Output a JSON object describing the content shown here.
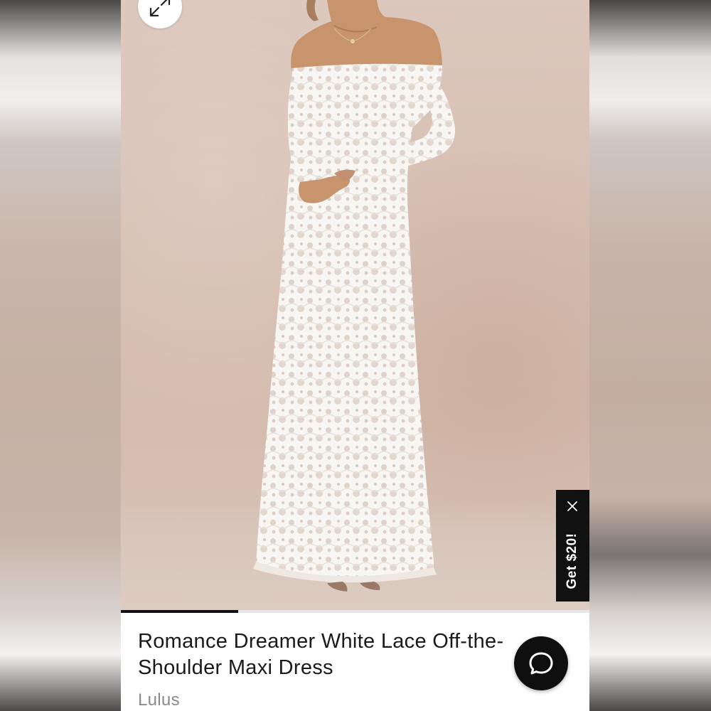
{
  "product": {
    "title_line1": "Romance Dreamer White Lace Off-the-",
    "title_line2": "Shoulder Maxi Dress",
    "brand": "Lulus"
  },
  "image_gallery": {
    "progress_fraction": 0.25
  },
  "promo": {
    "label": "Get $20!",
    "close_icon": "close-icon"
  },
  "icons": {
    "expand": "expand-arrows-icon",
    "chat": "chat-bubble-icon"
  },
  "colors": {
    "backdrop": "#d6bfb2",
    "dress": "#f7f4f1",
    "promo_bg": "#111111",
    "chat_bg": "#0f0f10",
    "brand_text": "#8a8a8a"
  }
}
